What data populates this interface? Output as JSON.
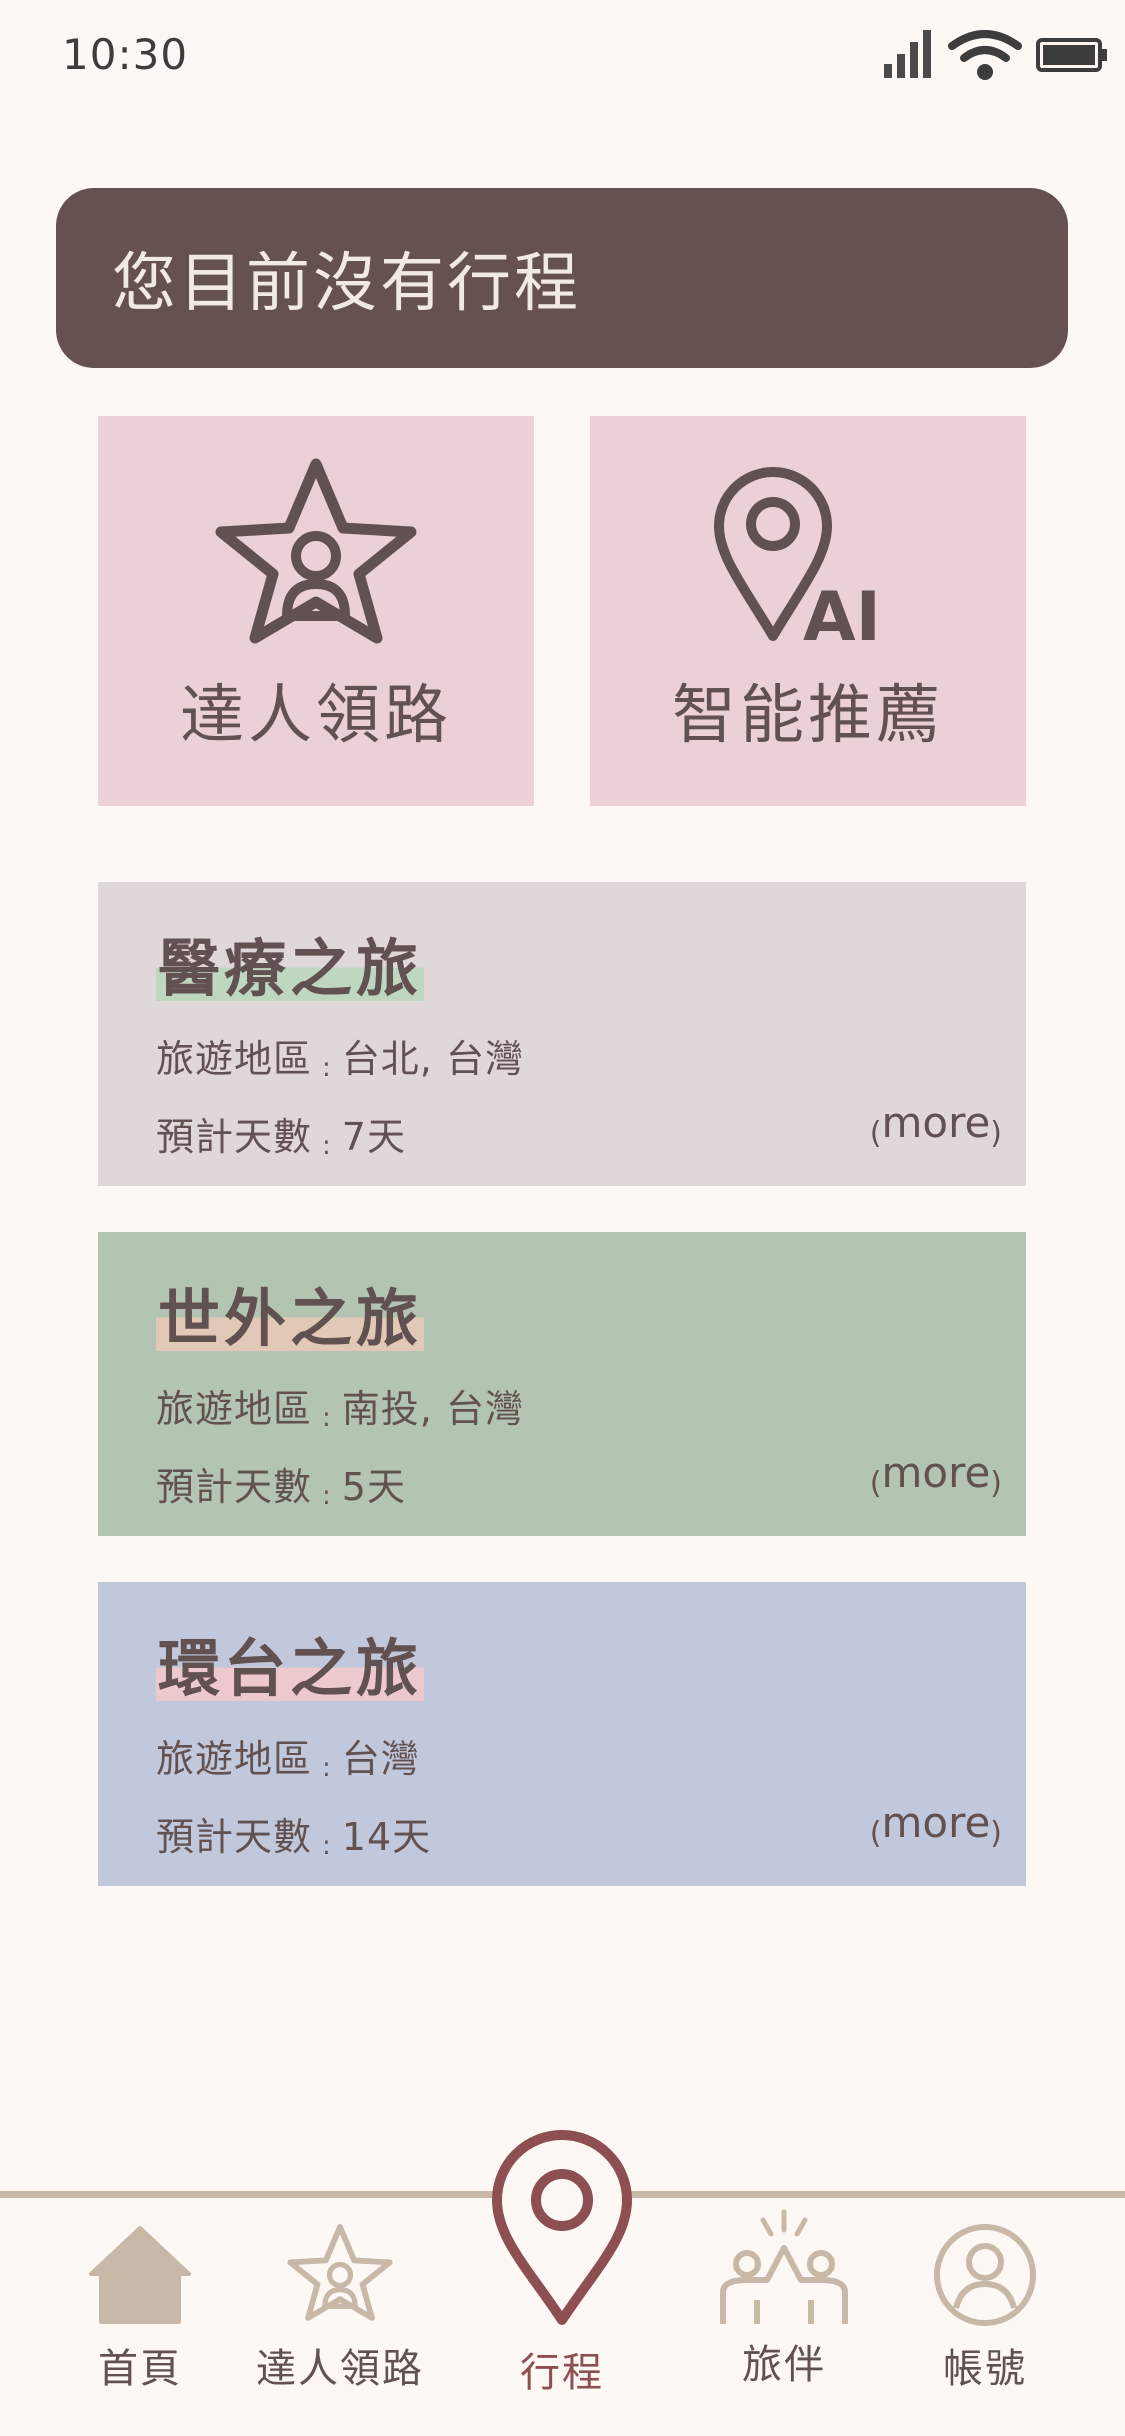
{
  "status_bar": {
    "time": "10:30"
  },
  "banner": {
    "text": "您目前沒有行程"
  },
  "features": {
    "expert": {
      "label": "達人領路",
      "icon": "star-person-icon"
    },
    "ai": {
      "label": "智能推薦",
      "icon": "location-pin-ai-icon",
      "icon_text": "AI"
    }
  },
  "trips": [
    {
      "title": "醫療之旅",
      "region_label": "旅遊地區",
      "region": "台北, 台灣",
      "days_label": "預計天數",
      "days": "7天",
      "more": "more",
      "bg": "#E0D8D8",
      "highlight": "#BFD6C0"
    },
    {
      "title": "世外之旅",
      "region_label": "旅遊地區",
      "region": "南投, 台灣",
      "days_label": "預計天數",
      "days": "5天",
      "more": "more",
      "bg": "#B4C4B2",
      "highlight": "#E2C8B6"
    },
    {
      "title": "環台之旅",
      "region_label": "旅遊地區",
      "region": "台灣",
      "days_label": "預計天數",
      "days": "14天",
      "more": "more",
      "bg": "#C2C8DC",
      "highlight": "#EDC9CD"
    }
  ],
  "nav": {
    "home": "首頁",
    "expert": "達人領路",
    "trips": "行程",
    "companions": "旅伴",
    "account": "帳號",
    "active": "trips"
  },
  "colors": {
    "background": "#FDF8F4",
    "banner": "#665151",
    "feature_card": "#EBD1D5",
    "text": "#625151",
    "nav_inactive": "#C7B8A8",
    "nav_active": "#8E4F52"
  }
}
